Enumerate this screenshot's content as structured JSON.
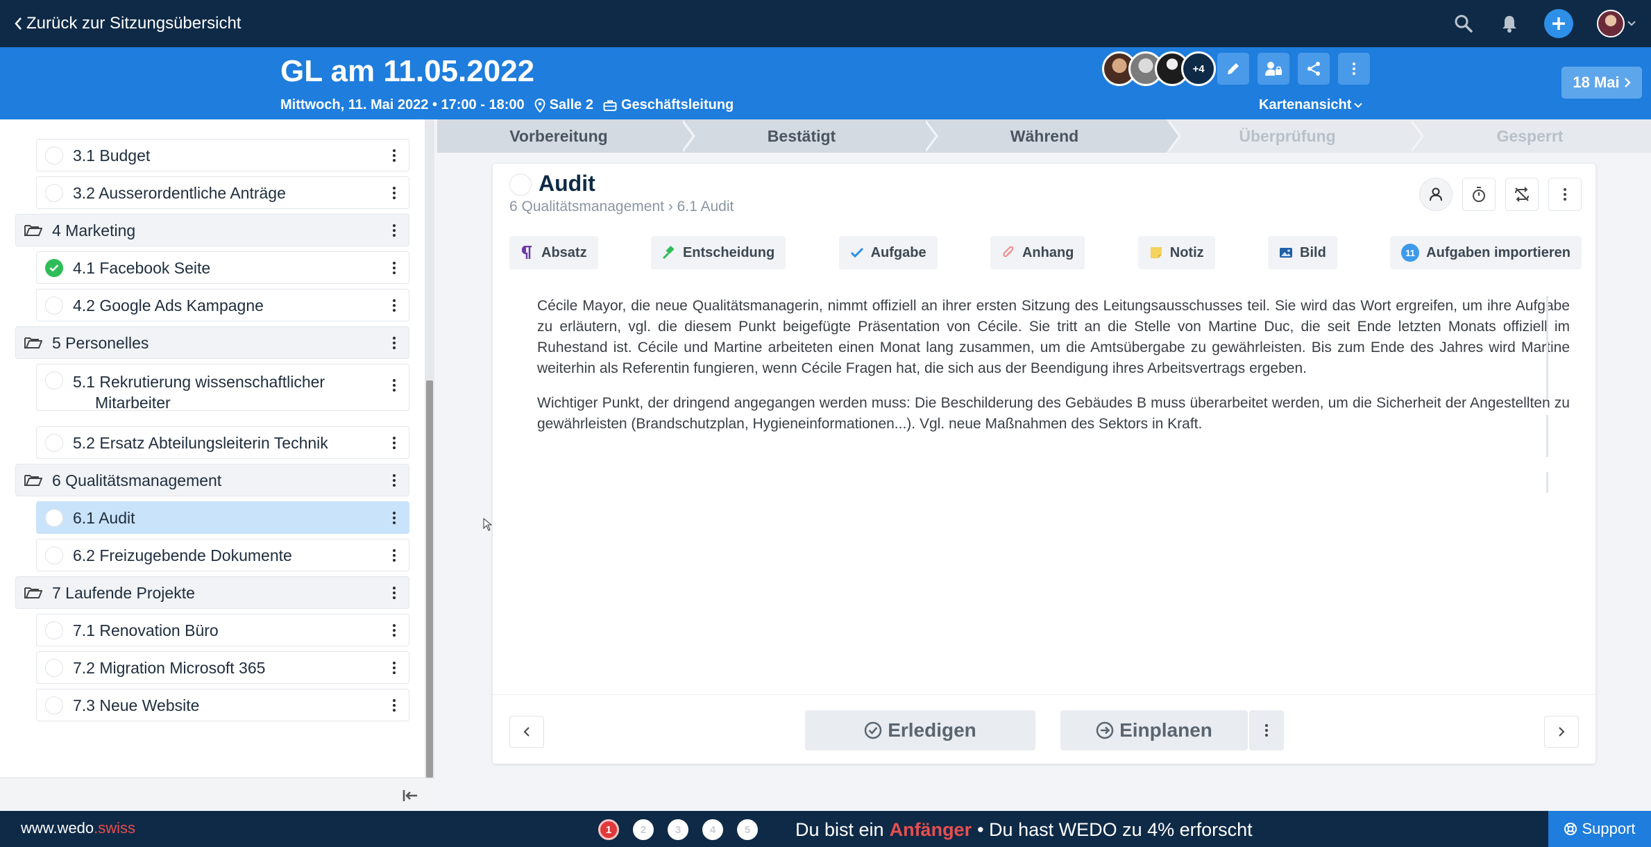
{
  "topbar": {
    "back_label": "Zurück zur Sitzungsübersicht",
    "icons": [
      "search-icon",
      "bell-icon",
      "plus-icon",
      "avatar"
    ]
  },
  "meeting": {
    "title": "GL am 11.05.2022",
    "datetime": "Mittwoch, 11. Mai 2022 • 17:00 - 18:00",
    "location": "Salle 2",
    "board": "Geschäftsleitung",
    "participants_more": "+4",
    "view_mode": "Kartenansicht",
    "next_meeting": "18 Mai"
  },
  "phases": [
    {
      "label": "Vorbereitung",
      "state": "done"
    },
    {
      "label": "Bestätigt",
      "state": "done"
    },
    {
      "label": "Während",
      "state": "current"
    },
    {
      "label": "Überprüfung",
      "state": "inactive"
    },
    {
      "label": "Gesperrt",
      "state": "inactive"
    }
  ],
  "agenda": {
    "items": [
      {
        "label": "3.1 Budget",
        "type": "item"
      },
      {
        "label": "3.2 Ausserordentliche Anträge",
        "type": "item"
      },
      {
        "label": "4 Marketing",
        "type": "section"
      },
      {
        "label": "4.1 Facebook Seite",
        "type": "item",
        "done": true
      },
      {
        "label": "4.2 Google Ads Kampagne",
        "type": "item"
      },
      {
        "label": "5 Personelles",
        "type": "section"
      },
      {
        "label": "5.1 Rekrutierung wissenschaftlicher",
        "label2": "Mitarbeiter",
        "type": "item"
      },
      {
        "label": "5.2 Ersatz Abteilungsleiterin Technik",
        "type": "item"
      },
      {
        "label": "6 Qualitätsmanagement",
        "type": "section"
      },
      {
        "label": "6.1 Audit",
        "type": "item",
        "selected": true
      },
      {
        "label": "6.2 Freizugebende Dokumente",
        "type": "item"
      },
      {
        "label": "7 Laufende Projekte",
        "type": "section"
      },
      {
        "label": "7.1 Renovation Büro",
        "type": "item"
      },
      {
        "label": "7.2 Migration Microsoft 365",
        "type": "item"
      },
      {
        "label": "7.3 Neue Website",
        "type": "item"
      }
    ]
  },
  "card": {
    "title": "Audit",
    "breadcrumb": "6 Qualitätsmanagement › 6.1 Audit",
    "toolbar": {
      "absatz": "Absatz",
      "entscheidung": "Entscheidung",
      "aufgabe": "Aufgabe",
      "anhang": "Anhang",
      "notiz": "Notiz",
      "bild": "Bild",
      "import": "Aufgaben importieren",
      "import_count": "11"
    },
    "paragraphs": [
      "Cécile Mayor, die neue Qualitätsmanagerin, nimmt offiziell an ihrer ersten Sitzung des Leitungsausschusses teil. Sie wird das Wort ergreifen, um ihre Aufgabe zu erläutern, vgl. die diesem Punkt beigefügte Präsentation von Cécile. Sie tritt an die Stelle von Martine Duc, die seit Ende letzten Monats offiziell im Ruhestand ist. Cécile und Martine arbeiteten einen Monat lang zusammen, um die Amtsübergabe zu gewährleisten. Bis zum Ende des Jahres wird Martine weiterhin als Referentin fungieren, wenn Cécile Fragen hat, die sich aus der Beendigung ihres Arbeitsvertrags ergeben.",
      "Wichtiger Punkt, der dringend angegangen werden muss: Die Beschilderung des Gebäudes B muss überarbeitet werden, um die Sicherheit der Angestellten zu gewährleisten (Brandschutzplan, Hygieneinformationen...). Vgl. neue Maßnahmen des Sektors in Kraft."
    ],
    "footer": {
      "complete_label": "Erledigen",
      "schedule_label": "Einplanen"
    }
  },
  "bottombar": {
    "brand_main": "www.wedo",
    "brand_accent": ".swiss",
    "steps": [
      "1",
      "2",
      "3",
      "4",
      "5"
    ],
    "level_prefix": "Du bist ein",
    "level_name": "Anfänger",
    "level_suffix": "• Du hast WEDO zu 4% erforscht",
    "support_label": "Support"
  },
  "colors": {
    "navy": "#0e2a47",
    "blue": "#1e7ddd",
    "green": "#2ebd59",
    "red": "#e84e4e",
    "selected": "#c9e3fb"
  }
}
